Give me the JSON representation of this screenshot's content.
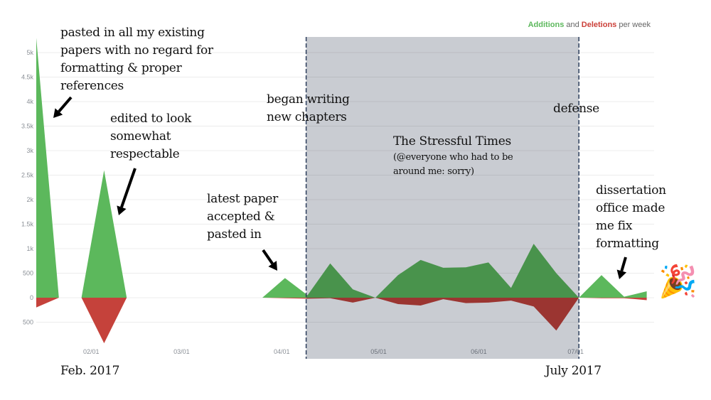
{
  "chart_data": {
    "type": "area",
    "title": "",
    "legend": {
      "placement": "top-right",
      "parts": [
        {
          "text": "Additions",
          "color": "#5cb85c"
        },
        {
          "text": " and ",
          "color": "#666666"
        },
        {
          "text": "Deletions",
          "color": "#cb3f38"
        },
        {
          "text": " per week",
          "color": "#666666"
        }
      ]
    },
    "x": [
      "2017-01-15",
      "2017-01-22",
      "2017-01-29",
      "2017-02-05",
      "2017-02-12",
      "2017-02-19",
      "2017-02-26",
      "2017-03-05",
      "2017-03-12",
      "2017-03-19",
      "2017-03-26",
      "2017-04-02",
      "2017-04-09",
      "2017-04-16",
      "2017-04-23",
      "2017-04-30",
      "2017-05-07",
      "2017-05-14",
      "2017-05-21",
      "2017-05-28",
      "2017-06-04",
      "2017-06-11",
      "2017-06-18",
      "2017-06-25",
      "2017-07-02",
      "2017-07-09",
      "2017-07-16",
      "2017-07-23"
    ],
    "series": [
      {
        "name": "Additions",
        "color": "#5cb85c",
        "values": [
          5300,
          0,
          0,
          2600,
          0,
          null,
          null,
          null,
          null,
          null,
          0,
          400,
          50,
          700,
          170,
          0,
          460,
          770,
          610,
          620,
          720,
          200,
          1100,
          500,
          0,
          460,
          20,
          130
        ]
      },
      {
        "name": "Deletions",
        "color": "#c5423b",
        "values": [
          200,
          0,
          0,
          930,
          0,
          null,
          null,
          null,
          null,
          null,
          0,
          10,
          20,
          10,
          100,
          0,
          130,
          160,
          30,
          110,
          100,
          60,
          180,
          670,
          0,
          10,
          10,
          50
        ]
      }
    ],
    "y_ticks": [
      {
        "value": 5000,
        "label": "5k"
      },
      {
        "value": 4500,
        "label": "4.5k"
      },
      {
        "value": 4000,
        "label": "4k"
      },
      {
        "value": 3500,
        "label": "3.5k"
      },
      {
        "value": 3000,
        "label": "3k"
      },
      {
        "value": 2500,
        "label": "2.5k"
      },
      {
        "value": 2000,
        "label": "2k"
      },
      {
        "value": 1500,
        "label": "1.5k"
      },
      {
        "value": 1000,
        "label": "1k"
      },
      {
        "value": 500,
        "label": "500"
      },
      {
        "value": 0,
        "label": "0"
      },
      {
        "value": -500,
        "label": "500"
      }
    ],
    "x_ticks": [
      {
        "date": "2017-02-01",
        "label": "02/01"
      },
      {
        "date": "2017-03-01",
        "label": "03/01"
      },
      {
        "date": "2017-04-01",
        "label": "04/01"
      },
      {
        "date": "2017-05-01",
        "label": "05/01"
      },
      {
        "date": "2017-06-01",
        "label": "06/01"
      },
      {
        "date": "2017-07-01",
        "label": "07/01"
      }
    ],
    "ylim": [
      -850,
      5400
    ],
    "grid": true,
    "highlight_region": {
      "start": "2017-04-09",
      "end": "2017-07-02",
      "color": "#c9ccd2",
      "border_color": "#2c3e5c"
    }
  },
  "annotations": {
    "pasted": "pasted in all my existing\npapers with no regard for\nformatting & proper\nreferences",
    "edited": "edited to look\nsomewhat\nrespectable",
    "began": "began writing\nnew chapters",
    "latest": "latest paper\naccepted &\npasted in",
    "defense": "defense",
    "stressful_title": "The Stressful Times",
    "stressful_sub": "(@everyone who had to be\naround me: sorry)",
    "dissertation": "dissertation\noffice made\nme fix\nformatting",
    "feb": "Feb. 2017",
    "july": "July 2017",
    "celebration_icon": "party-popper-icon",
    "celebration_glyph": "🎉"
  }
}
